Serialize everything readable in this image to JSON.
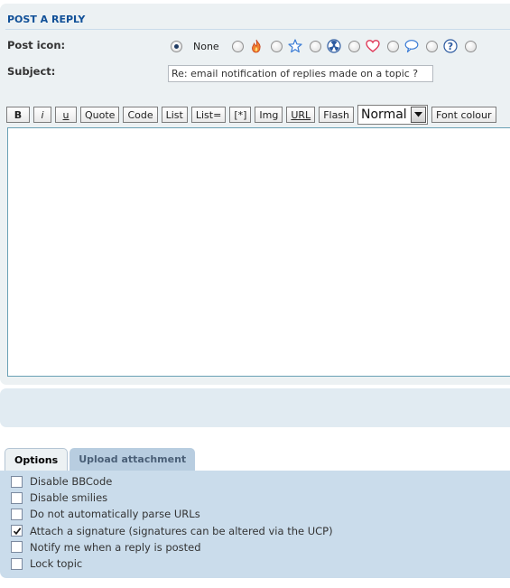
{
  "heading": "POST A REPLY",
  "post_icon_label": "Post icon:",
  "none_label": "None",
  "icons": [
    "fire-icon",
    "star-icon",
    "radioactive-icon",
    "heart-icon",
    "speech-bubble-icon",
    "question-icon"
  ],
  "subject_label": "Subject:",
  "subject_value": "Re: email notification of replies made on a topic ?",
  "toolbar": {
    "bold": "B",
    "italic": "i",
    "underline": "u",
    "quote": "Quote",
    "code": "Code",
    "list": "List",
    "list_eq": "List=",
    "list_item": "[*]",
    "img": "Img",
    "url": "URL",
    "flash": "Flash",
    "font_size": "Normal",
    "font_colour": "Font colour"
  },
  "message_value": "",
  "tabs": {
    "options": "Options",
    "upload": "Upload attachment"
  },
  "options": [
    {
      "label": "Disable BBCode",
      "checked": false
    },
    {
      "label": "Disable smilies",
      "checked": false
    },
    {
      "label": "Do not automatically parse URLs",
      "checked": false
    },
    {
      "label": "Attach a signature (signatures can be altered via the UCP)",
      "checked": true
    },
    {
      "label": "Notify me when a reply is posted",
      "checked": false
    },
    {
      "label": "Lock topic",
      "checked": false
    }
  ],
  "colors": {
    "heading": "#115098",
    "panel": "#ecf1f3",
    "options_panel": "#cadceb",
    "textarea_border": "#6aa0b5"
  }
}
